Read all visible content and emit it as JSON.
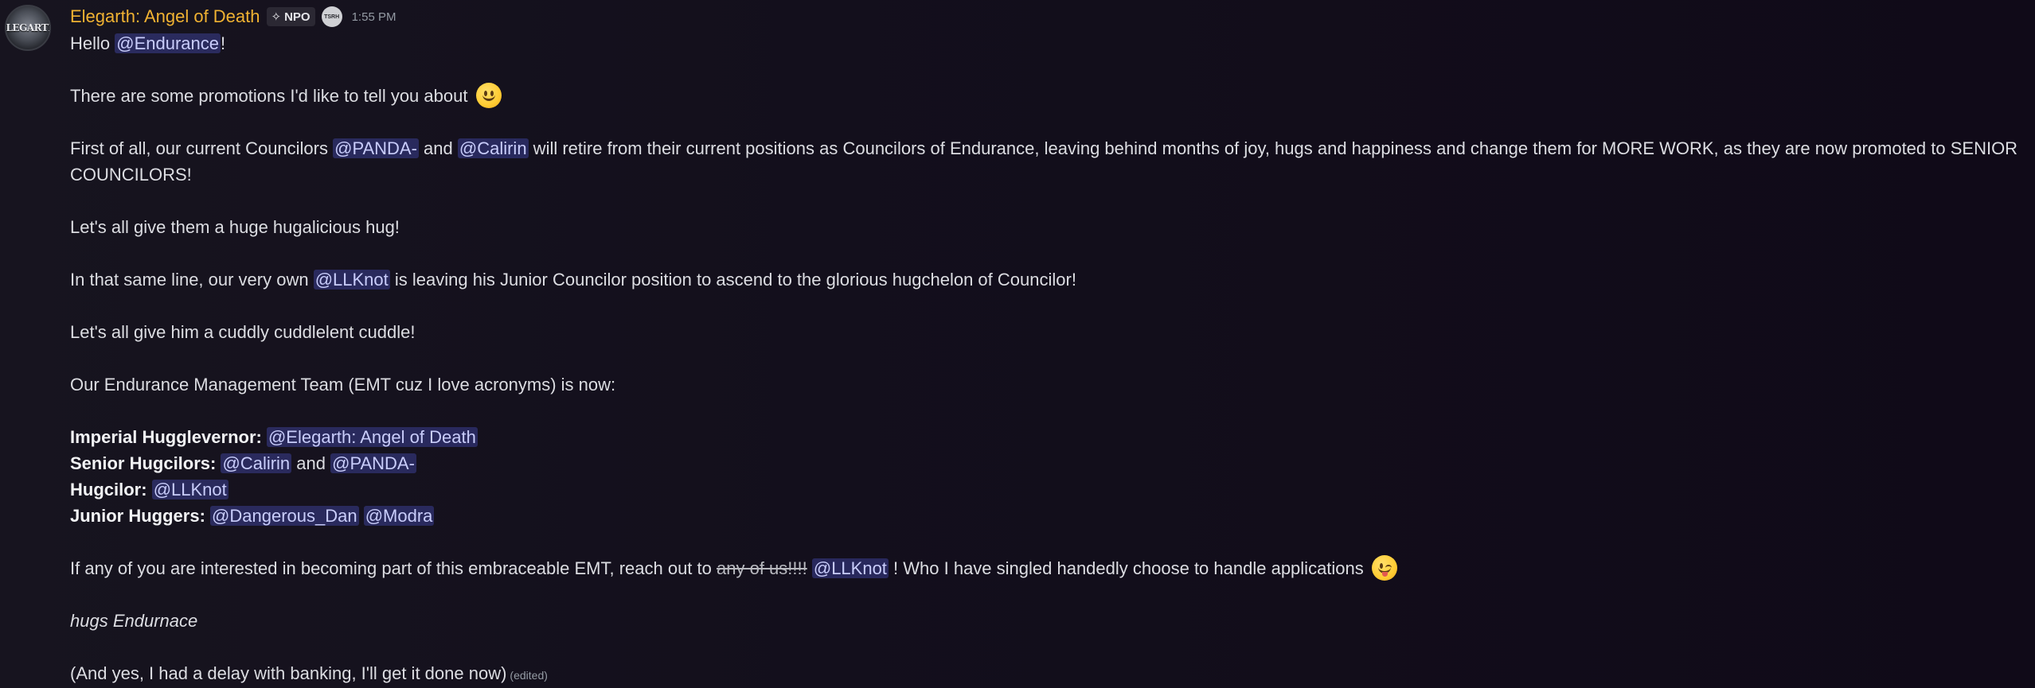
{
  "author": {
    "name": "Elegarth: Angel of Death",
    "avatar_text": "ELEGARTH",
    "tag_icon": "sparkle-icon",
    "tag_label": "NPO",
    "clan_badge_text": "TSRH",
    "timestamp": "1:55 PM"
  },
  "message": {
    "l1": {
      "a": "Hello ",
      "mention": "@Endurance",
      "b": "!"
    },
    "l2": {
      "text": "There are some promotions I'd like to tell you about",
      "emoji": "slightly-smiling-face"
    },
    "l3": {
      "a": "First of all, our current Councilors ",
      "m1": "@PANDA-",
      "b": " and ",
      "m2": "@Calirin",
      "c": " will retire from their current positions as Councilors of Endurance, leaving behind months of joy, hugs and happiness and change them for MORE WORK, as they are now promoted to SENIOR COUNCILORS!"
    },
    "l4": "Let's all give them a huge hugalicious hug!",
    "l5": {
      "a": "In that same line, our very own ",
      "mention": "@LLKnot",
      "b": " is leaving his Junior Councilor position to ascend to the glorious hugchelon of Councilor!"
    },
    "l6": "Let's all give him a cuddly cuddlelent cuddle!",
    "l7": "Our Endurance Management Team (EMT cuz I love acronyms) is now:",
    "team": {
      "r1_label": "Imperial Hugglevernor:",
      "r1_m1": "@Elegarth: Angel of Death",
      "r2_label": "Senior Hugcilors:",
      "r2_m1": "@Calirin",
      "r2_and": " and ",
      "r2_m2": "@PANDA-",
      "r3_label": "Hugcilor:",
      "r3_m1": "@LLKnot",
      "r4_label": "Junior Huggers:",
      "r4_m1": "@Dangerous_Dan",
      "r4_m2": "@Modra"
    },
    "l8": {
      "a": "If any of you are interested in becoming part of this embraceable EMT, reach out to ",
      "strike": "any of us!!!!",
      "mention": "@LLKnot",
      "b": " ! Who I have singled handedly choose to handle applications",
      "emoji": "winking-face"
    },
    "l9": "hugs Endurnace",
    "l10": "(And yes, I had a delay with banking, I'll get it done now)",
    "edited": "(edited)"
  }
}
